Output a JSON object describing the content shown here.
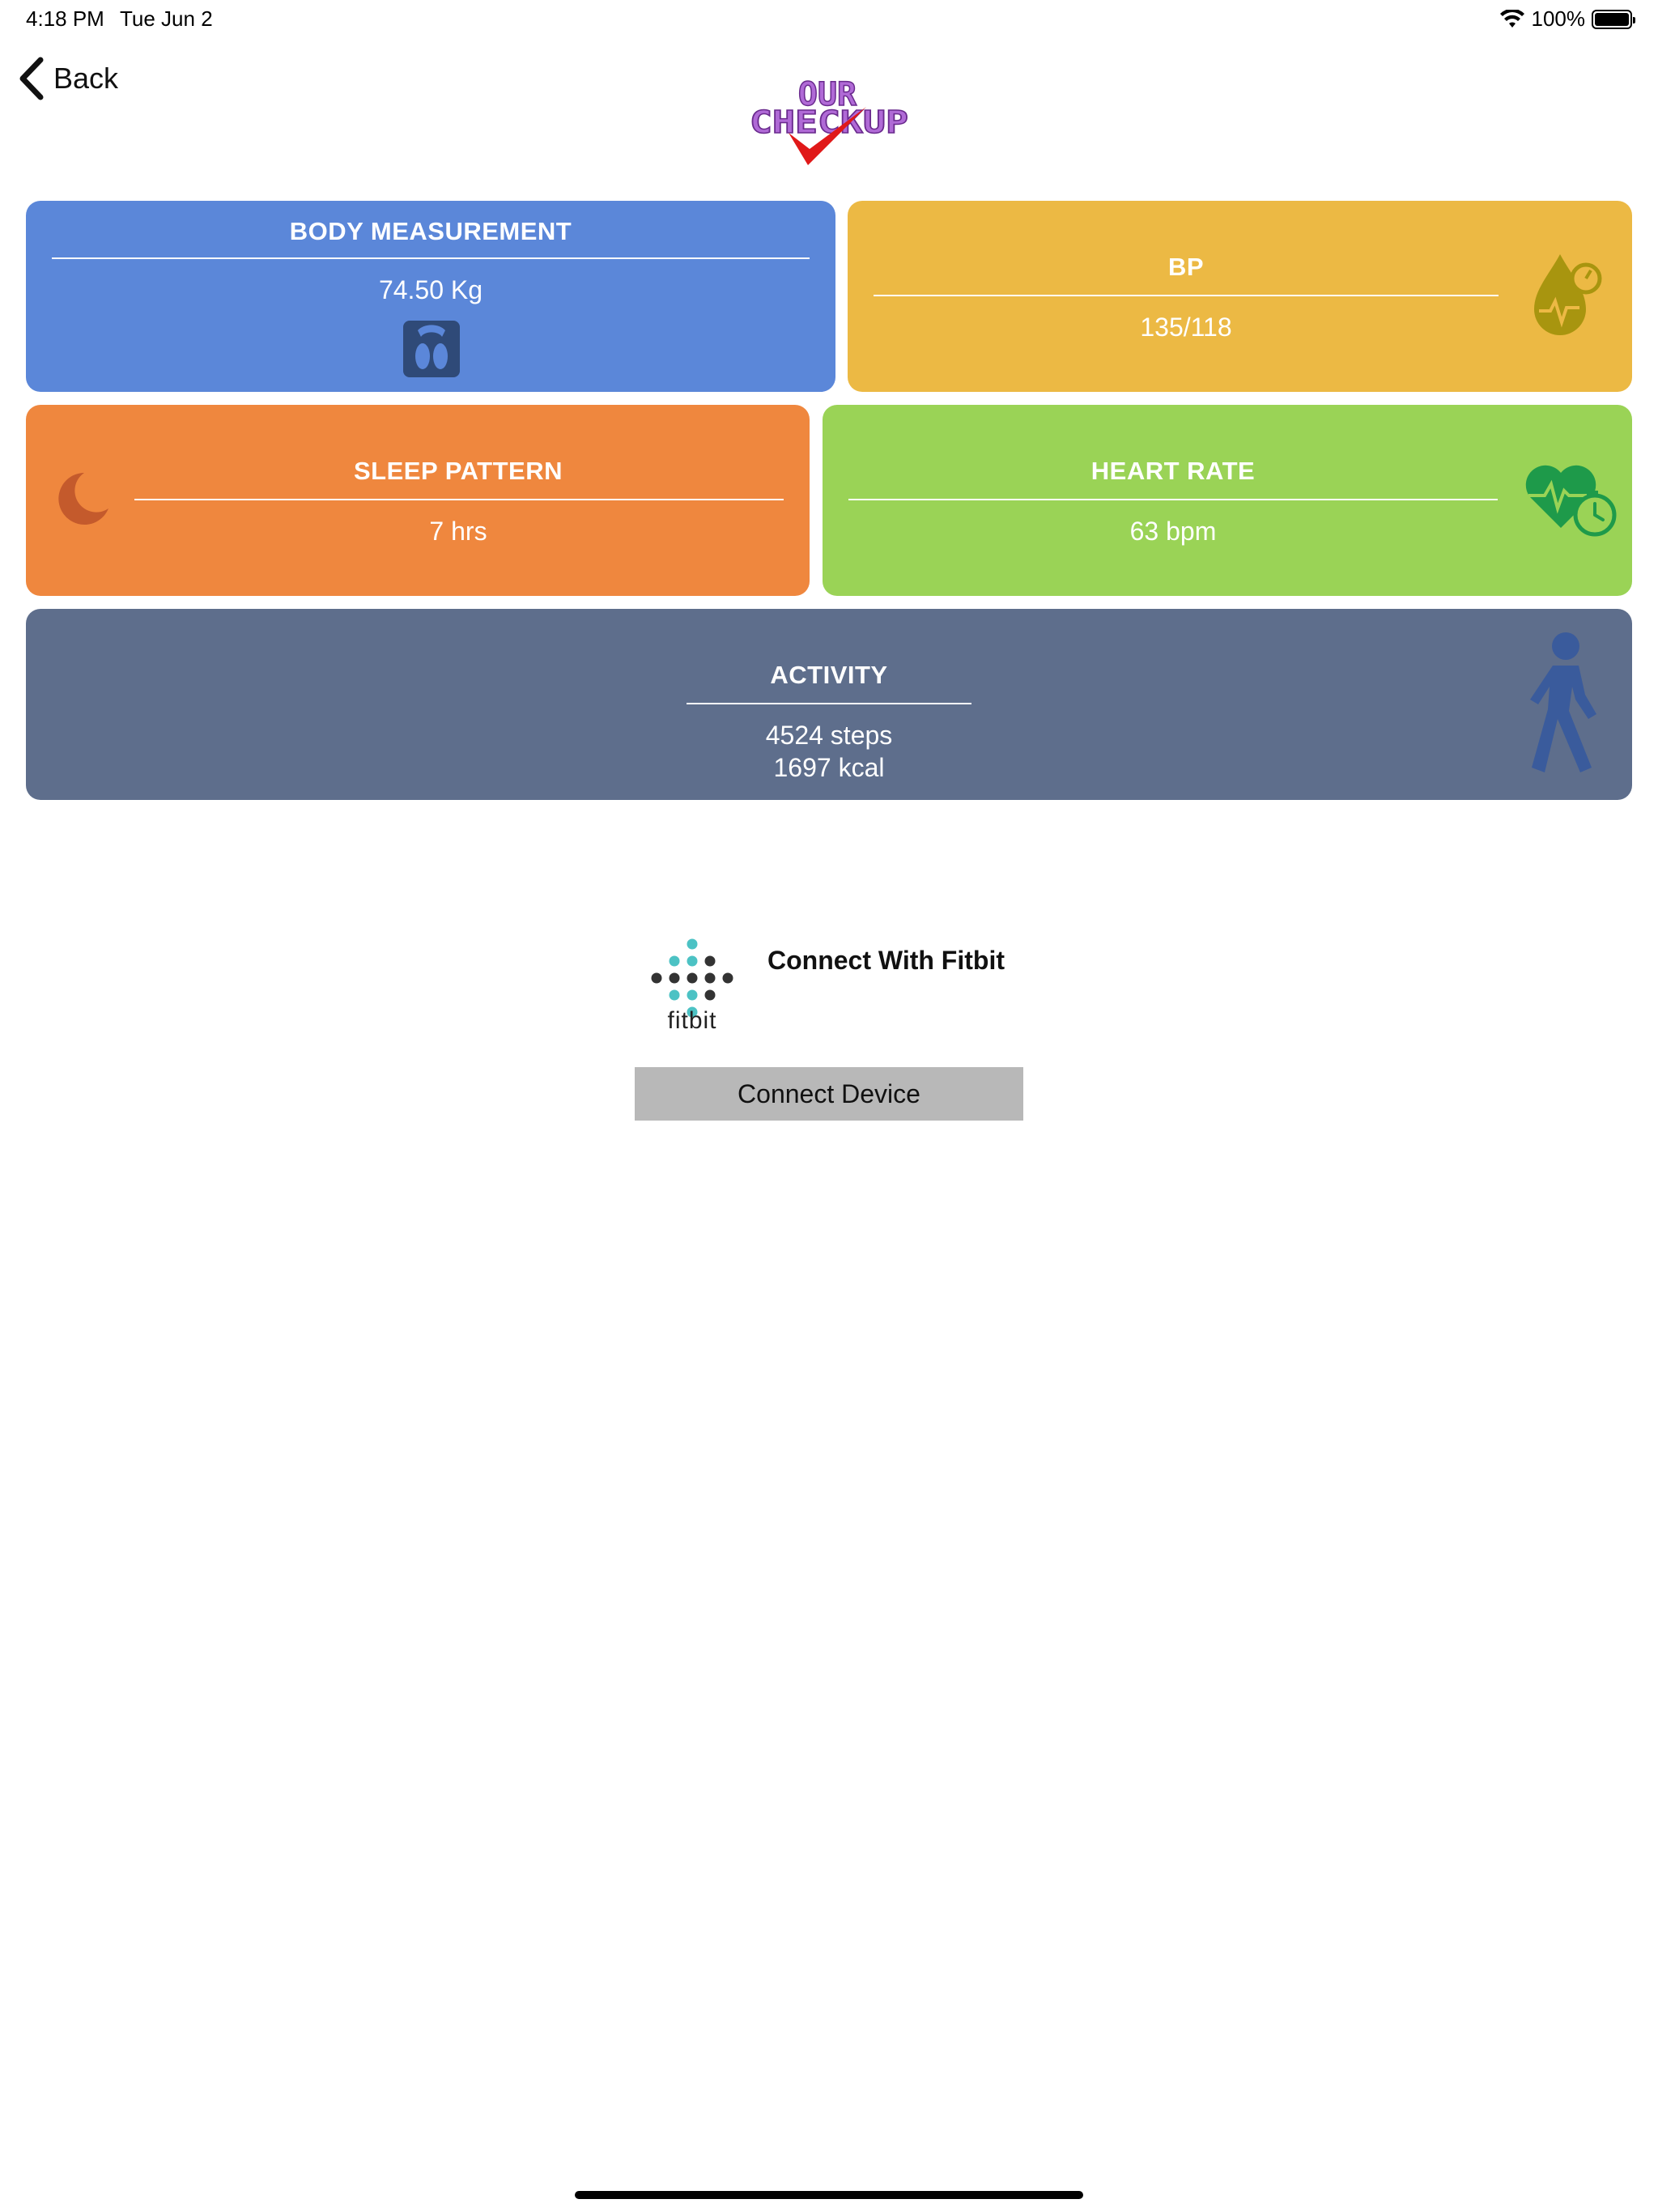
{
  "status_bar": {
    "time": "4:18 PM",
    "date": "Tue Jun 2",
    "battery": "100%",
    "battery_level": 1.0
  },
  "nav": {
    "back_label": "Back",
    "logo_alt": "OUR CHECKUP",
    "logo_line1": "OUR",
    "logo_line2": "CHECKUP"
  },
  "tiles": {
    "body": {
      "title": "BODY MEASUREMENT",
      "value": "74.50 Kg",
      "color": "#5b87d9",
      "icon": "scale-icon"
    },
    "bp": {
      "title": "BP",
      "value": "135/118",
      "color": "#ecb944",
      "icon": "blood-drop-gauge-icon"
    },
    "sleep": {
      "title": "SLEEP PATTERN",
      "value": "7 hrs",
      "color": "#ef873e",
      "icon": "moon-icon"
    },
    "heart": {
      "title": "HEART RATE",
      "value": "63 bpm",
      "color": "#9ad356",
      "icon": "heart-pulse-timer-icon"
    },
    "activity": {
      "title": "ACTIVITY",
      "steps": "4524 steps",
      "kcal": "1697 kcal",
      "color": "#5e6e8c",
      "icon": "walking-person-icon"
    }
  },
  "fitbit": {
    "brand": "fitbit",
    "connect_label": "Connect With Fitbit",
    "button_label": "Connect Device"
  }
}
